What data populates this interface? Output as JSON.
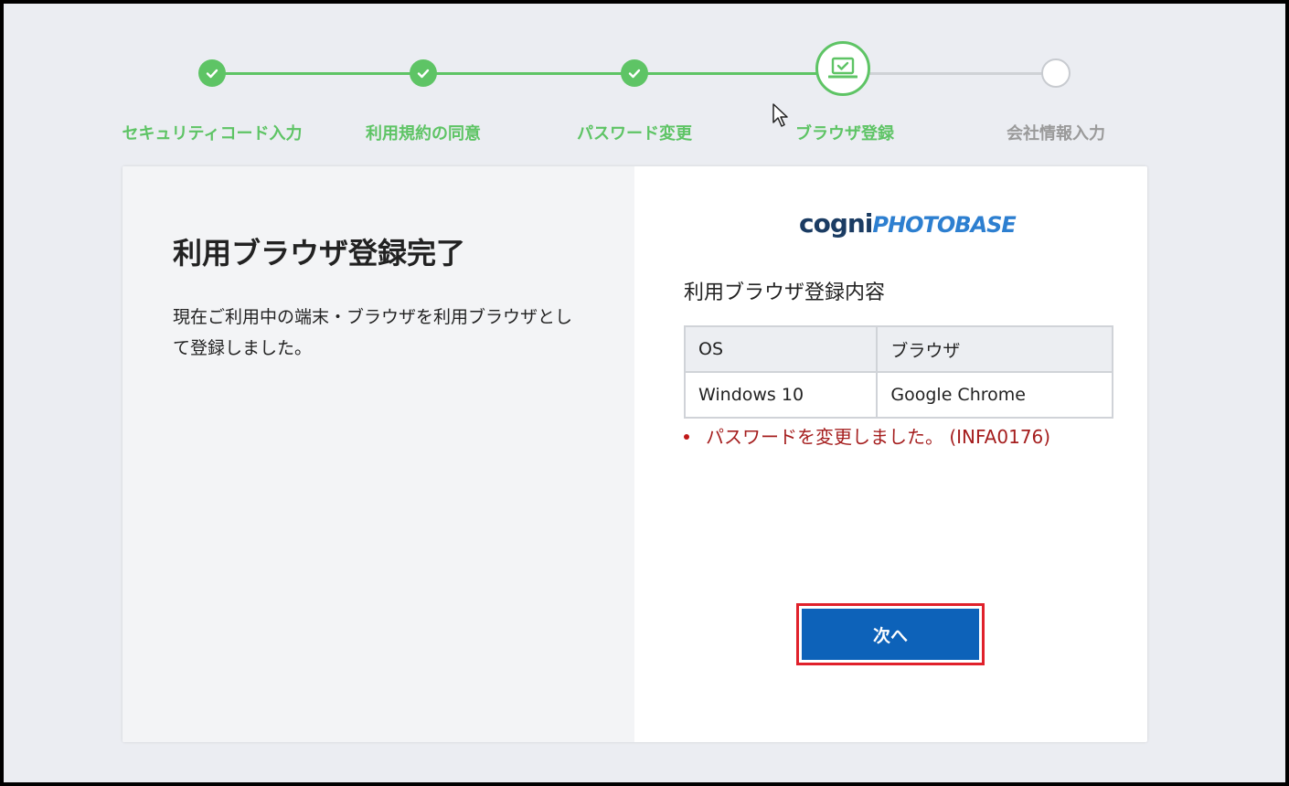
{
  "stepper": {
    "steps": [
      {
        "label": "セキュリティコード入力",
        "state": "done"
      },
      {
        "label": "利用規約の同意",
        "state": "done"
      },
      {
        "label": "パスワード変更",
        "state": "done"
      },
      {
        "label": "ブラウザ登録",
        "state": "current"
      },
      {
        "label": "会社情報入力",
        "state": "todo"
      }
    ]
  },
  "left": {
    "title": "利用ブラウザ登録完了",
    "description": "現在ご利用中の端末・ブラウザを利用ブラウザとして登録しました。"
  },
  "logo": {
    "part1": "cogni",
    "part2": "PHOTOBASE"
  },
  "right": {
    "subtitle": "利用ブラウザ登録内容",
    "table": {
      "headers": [
        "OS",
        "ブラウザ"
      ],
      "rows": [
        [
          "Windows 10",
          "Google Chrome"
        ]
      ]
    },
    "message": "パスワードを変更しました。 (INFA0176)",
    "next_label": "次へ"
  },
  "colors": {
    "accent_green": "#5ec465",
    "button_blue": "#0d62b9",
    "error_red": "#a51e1e",
    "highlight_red": "#e0212b"
  }
}
